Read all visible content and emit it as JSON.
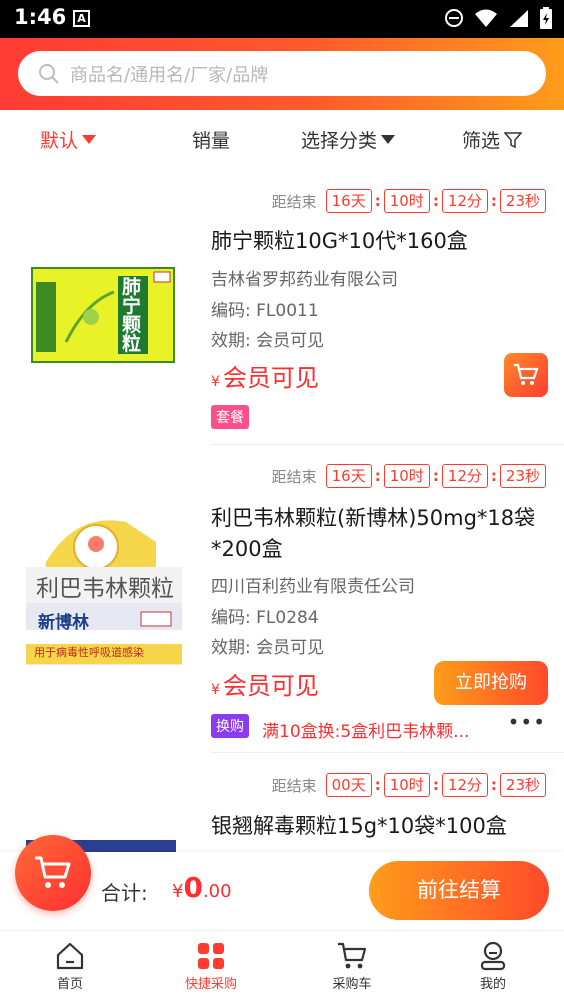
{
  "status_bar": {
    "time": "1:46",
    "badge": "A"
  },
  "search": {
    "placeholder": "商品名/通用名/厂家/品牌"
  },
  "tabs": [
    {
      "label": "默认"
    },
    {
      "label": "销量"
    },
    {
      "label": "选择分类"
    },
    {
      "label": "筛选"
    }
  ],
  "countdown_label": "距结束",
  "products": [
    {
      "name": "肺宁颗粒10G*10代*160盒",
      "maker": "吉林省罗邦药业有限公司",
      "code": "编码: FL0011",
      "expiry": "效期: 会员可见",
      "price_symbol": "¥",
      "price": "会员可见",
      "countdown": {
        "days": "16天",
        "hours": "10时",
        "minutes": "12分",
        "seconds": "23秒"
      },
      "tag": "套餐",
      "box_text": "肺宁颗粒"
    },
    {
      "name": "利巴韦林颗粒(新博林)50mg*18袋*200盒",
      "maker": "四川百利药业有限责任公司",
      "code": "编码: FL0284",
      "expiry": "效期: 会员可见",
      "price_symbol": "¥",
      "price": "会员可见",
      "countdown": {
        "days": "16天",
        "hours": "10时",
        "minutes": "12分",
        "seconds": "23秒"
      },
      "tag": "换购",
      "promo": "满10盒换:5盒利巴韦林颗...",
      "more": "•••",
      "buy_label": "立即抢购",
      "box_text": "利巴韦林颗粒",
      "box_brand": "新博林",
      "box_desc": "用于病毒性呼吸道感染"
    },
    {
      "name": "银翘解毒颗粒15g*10袋*100盒",
      "countdown": {
        "days": "00天",
        "hours": "10时",
        "minutes": "12分",
        "seconds": "23秒"
      }
    }
  ],
  "checkout": {
    "total_label": "合计:",
    "currency": "¥",
    "total_int": "0",
    "total_dec": ".00",
    "button": "前往结算"
  },
  "nav": [
    {
      "label": "首页",
      "icon": "home-icon"
    },
    {
      "label": "快捷采购",
      "icon": "grid-icon"
    },
    {
      "label": "采购车",
      "icon": "cart-icon"
    },
    {
      "label": "我的",
      "icon": "user-icon"
    }
  ],
  "colors": {
    "accent": "#ff3b30",
    "orange": "#ff9c1a",
    "tag_combo": "#ff4f8a",
    "tag_exchange": "#8b3cf0"
  }
}
